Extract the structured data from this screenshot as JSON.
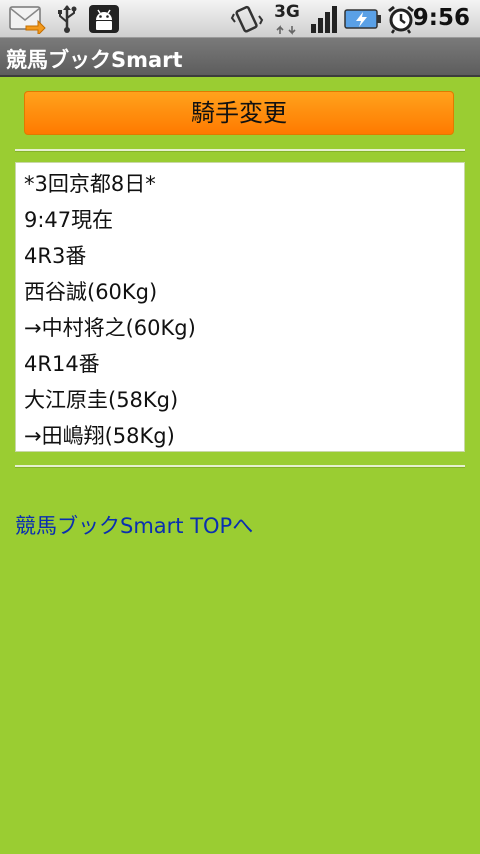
{
  "status_bar": {
    "time": "9:56",
    "network_type": "3G",
    "icons": [
      "mail-notification-icon",
      "usb-icon",
      "android-debug-icon",
      "vibrate-icon",
      "3g-data-icon",
      "signal-icon",
      "battery-charging-icon",
      "alarm-icon"
    ]
  },
  "app": {
    "title": "競馬ブックSmart"
  },
  "main": {
    "change_button_label": "騎手変更",
    "info_lines": [
      "*3回京都8日*",
      "9:47現在",
      "4R3番",
      "西谷誠(60Kg)",
      "→中村将之(60Kg)",
      "4R14番",
      "大江原圭(58Kg)",
      "→田嶋翔(58Kg)"
    ],
    "top_link_label": "競馬ブックSmart TOPへ"
  },
  "colors": {
    "background": "#9acd32",
    "button": "#ff8c00",
    "link": "#0a2fb0"
  }
}
